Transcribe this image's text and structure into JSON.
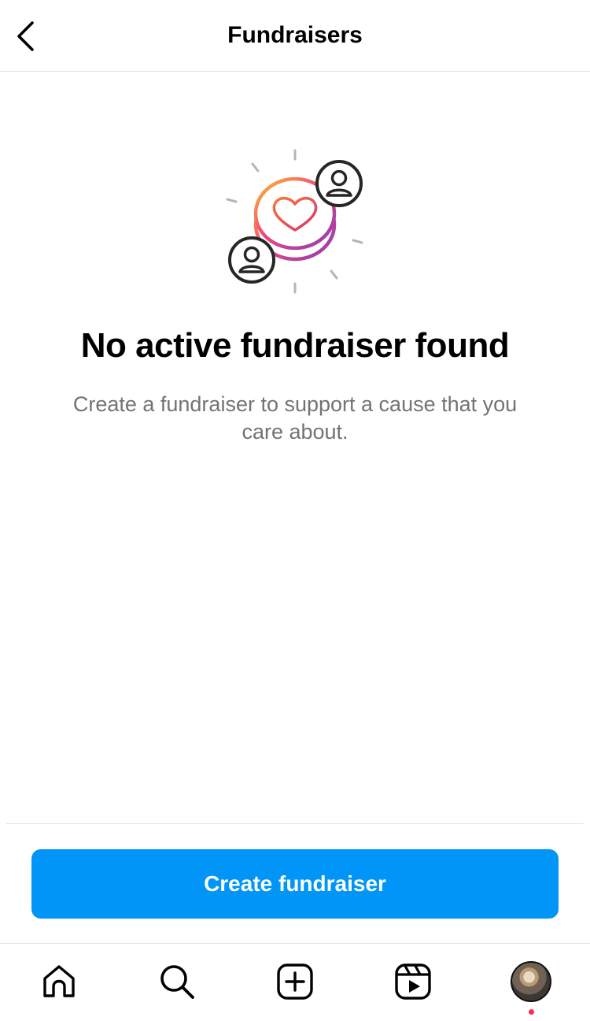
{
  "header": {
    "title": "Fundraisers",
    "back_icon": "chevron-left-icon"
  },
  "illustration": {
    "icons": [
      "heart-coin-icon",
      "person-icon",
      "person-icon"
    ],
    "gradient_colors": [
      "#f9a825",
      "#ee2a7b",
      "#c13584",
      "#8a3ab9"
    ]
  },
  "empty_state": {
    "title": "No active fundraiser found",
    "description": "Create a fundraiser to support a cause that you care about."
  },
  "cta": {
    "label": "Create fundraiser",
    "color": "#0095f6"
  },
  "tabbar": {
    "tabs": [
      {
        "name": "home",
        "icon": "home-icon"
      },
      {
        "name": "search",
        "icon": "search-icon"
      },
      {
        "name": "create",
        "icon": "plus-square-icon"
      },
      {
        "name": "reels",
        "icon": "reels-icon"
      },
      {
        "name": "profile",
        "icon": "avatar"
      }
    ],
    "notification_dot_color": "#ff2d55"
  }
}
